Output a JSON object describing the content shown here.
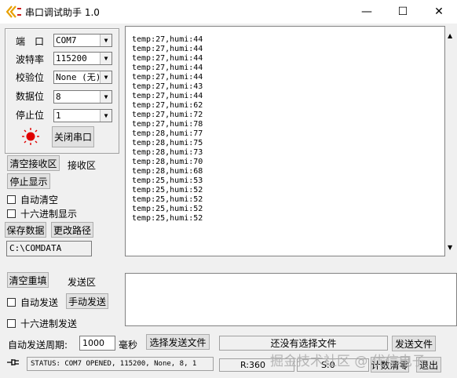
{
  "window": {
    "title": "串口调试助手 1.0",
    "minimize": "—",
    "maximize": "☐",
    "close": "✕"
  },
  "settings": {
    "port_label": "端　口",
    "port_value": "COM7",
    "baud_label": "波特率",
    "baud_value": "115200",
    "parity_label": "校验位",
    "parity_value": "None (无)",
    "databits_label": "数据位",
    "databits_value": "8",
    "stopbits_label": "停止位",
    "stopbits_value": "1",
    "close_port_button": "关闭串口",
    "status_led_color": "#e00000"
  },
  "receive": {
    "clear_button": "清空接收区",
    "area_label": "接收区",
    "stop_display_button": "停止显示",
    "auto_clear_label": "自动清空",
    "hex_display_label": "十六进制显示",
    "save_data_button": "保存数据",
    "change_path_button": "更改路径",
    "path_value": "C:\\COMDATA",
    "lines": [
      "temp:27,humi:44",
      "temp:27,humi:44",
      "temp:27,humi:44",
      "temp:27,humi:44",
      "temp:27,humi:44",
      "temp:27,humi:43",
      "temp:27,humi:44",
      "temp:27,humi:62",
      "temp:27,humi:72",
      "temp:27,humi:78",
      "temp:28,humi:77",
      "temp:28,humi:75",
      "temp:28,humi:73",
      "temp:28,humi:70",
      "temp:28,humi:68",
      "temp:25,humi:53",
      "temp:25,humi:52",
      "temp:25,humi:52",
      "temp:25,humi:52",
      "temp:25,humi:52"
    ]
  },
  "send": {
    "clear_button": "清空重填",
    "area_label": "发送区",
    "auto_send_label": "自动发送",
    "manual_send_button": "手动发送",
    "hex_send_label": "十六进制发送",
    "period_label": "自动发送周期:",
    "period_value": "1000",
    "period_unit": "毫秒",
    "select_file_button": "选择发送文件",
    "file_status": "还没有选择文件",
    "send_file_button": "发送文件"
  },
  "statusbar": {
    "status_text": "STATUS: COM7 OPENED, 115200, None, 8, 1",
    "rx_count": "R:360",
    "tx_count": "S:0",
    "clear_count_button": "计数清零",
    "exit_button": "退出"
  },
  "watermark": "掘金技术社区 @ 优信电子"
}
